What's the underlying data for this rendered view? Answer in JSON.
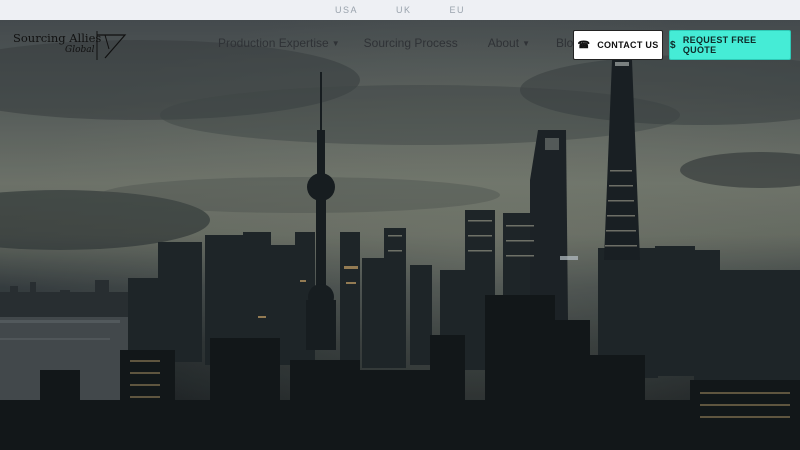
{
  "region_bar": {
    "items": [
      "USA",
      "UK",
      "EU"
    ]
  },
  "logo": {
    "name": "Sourcing Allies",
    "tagline": "Global"
  },
  "nav": {
    "items": [
      {
        "label": "Production Expertise",
        "has_dropdown": true
      },
      {
        "label": "Sourcing Process",
        "has_dropdown": false
      },
      {
        "label": "About",
        "has_dropdown": true
      },
      {
        "label": "Blog",
        "has_dropdown": false
      }
    ]
  },
  "cta": {
    "contact_label": "CONTACT US",
    "contact_icon": "phone-icon",
    "quote_label": "REQUEST FREE QUOTE",
    "quote_icon": "dollar-icon"
  },
  "colors": {
    "accent": "#45ecd6",
    "topbar": "#eef0f4"
  }
}
